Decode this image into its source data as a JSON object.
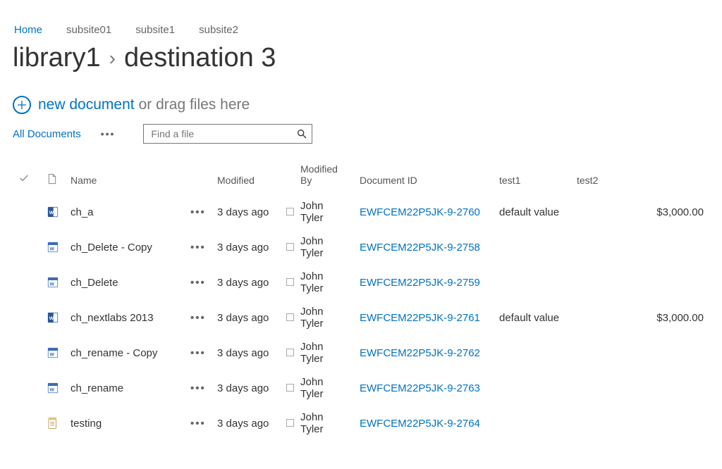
{
  "topnav": {
    "items": [
      {
        "label": "Home",
        "active": true
      },
      {
        "label": "subsite01",
        "active": false
      },
      {
        "label": "subsite1",
        "active": false
      },
      {
        "label": "subsite2",
        "active": false
      }
    ]
  },
  "title": {
    "library": "library1",
    "separator": "›",
    "folder": "destination 3"
  },
  "newdoc": {
    "link_label": "new document",
    "hint": "or drag files here"
  },
  "toolbar": {
    "view_label": "All Documents",
    "search_placeholder": "Find a file"
  },
  "columns": {
    "name": "Name",
    "modified": "Modified",
    "modified_by": "Modified By",
    "document_id": "Document ID",
    "test1": "test1",
    "test2": "test2"
  },
  "rows": [
    {
      "icon": "docx",
      "name": "ch_a",
      "modified": "3 days ago",
      "modified_by": "John Tyler",
      "document_id": "EWFCEM22P5JK-9-2760",
      "test1": "default value",
      "test2": "$3,000.00"
    },
    {
      "icon": "doc",
      "name": "ch_Delete - Copy",
      "modified": "3 days ago",
      "modified_by": "John Tyler",
      "document_id": "EWFCEM22P5JK-9-2758",
      "test1": "",
      "test2": ""
    },
    {
      "icon": "doc",
      "name": "ch_Delete",
      "modified": "3 days ago",
      "modified_by": "John Tyler",
      "document_id": "EWFCEM22P5JK-9-2759",
      "test1": "",
      "test2": ""
    },
    {
      "icon": "docx",
      "name": "ch_nextlabs 2013",
      "modified": "3 days ago",
      "modified_by": "John Tyler",
      "document_id": "EWFCEM22P5JK-9-2761",
      "test1": "default value",
      "test2": "$3,000.00"
    },
    {
      "icon": "doc",
      "name": "ch_rename - Copy",
      "modified": "3 days ago",
      "modified_by": "John Tyler",
      "document_id": "EWFCEM22P5JK-9-2762",
      "test1": "",
      "test2": ""
    },
    {
      "icon": "doc",
      "name": "ch_rename",
      "modified": "3 days ago",
      "modified_by": "John Tyler",
      "document_id": "EWFCEM22P5JK-9-2763",
      "test1": "",
      "test2": ""
    },
    {
      "icon": "note",
      "name": "testing",
      "modified": "3 days ago",
      "modified_by": "John Tyler",
      "document_id": "EWFCEM22P5JK-9-2764",
      "test1": "",
      "test2": ""
    }
  ]
}
